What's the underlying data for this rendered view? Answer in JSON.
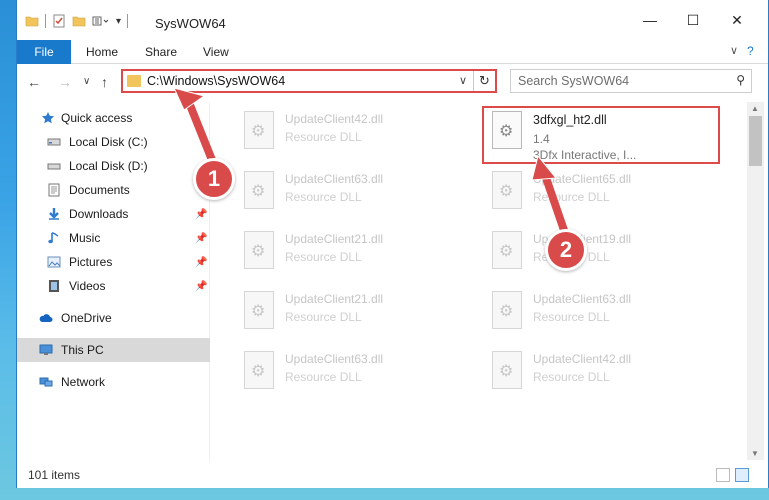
{
  "window": {
    "title": "SysWOW64"
  },
  "window_controls": {
    "minimize": "—",
    "maximize": "☐",
    "close": "✕"
  },
  "ribbon": {
    "tabs": [
      {
        "label": "File",
        "active": true
      },
      {
        "label": "Home"
      },
      {
        "label": "Share"
      },
      {
        "label": "View"
      }
    ],
    "help_icon": "?",
    "expand_icon": "∨"
  },
  "address_bar": {
    "path": "C:\\Windows\\SysWOW64",
    "refresh_icon": "↻",
    "chevron_icon": "∨"
  },
  "search": {
    "placeholder": "Search SysWOW64",
    "icon": "⚲"
  },
  "nav_buttons": {
    "back": "←",
    "forward": "→",
    "recent": "∨",
    "up": "↑"
  },
  "navigation_pane": {
    "items": [
      {
        "label": "Quick access",
        "icon": "star-icon",
        "pinned": false
      },
      {
        "label": "Local Disk (C:)",
        "icon": "drive-icon",
        "pinned": false
      },
      {
        "label": "Local Disk (D:)",
        "icon": "drive-icon",
        "pinned": false
      },
      {
        "label": "Documents",
        "icon": "documents-icon",
        "pinned": false
      },
      {
        "label": "Downloads",
        "icon": "download-icon",
        "pinned": true
      },
      {
        "label": "Music",
        "icon": "music-icon",
        "pinned": true
      },
      {
        "label": "Pictures",
        "icon": "pictures-icon",
        "pinned": true
      },
      {
        "label": "Videos",
        "icon": "videos-icon",
        "pinned": true
      },
      {
        "label": "OneDrive",
        "icon": "cloud-icon",
        "pinned": false
      },
      {
        "label": "This PC",
        "icon": "computer-icon",
        "pinned": false,
        "selected": true
      },
      {
        "label": "Network",
        "icon": "network-icon",
        "pinned": false
      }
    ],
    "pin_glyph": "📌"
  },
  "files": {
    "left_column": [
      {
        "name": "UpdateClient42.dll",
        "type": "Resource DLL"
      },
      {
        "name": "UpdateClient63.dll",
        "type": "Resource DLL"
      },
      {
        "name": "UpdateClient21.dll",
        "type": "Resource DLL"
      },
      {
        "name": "UpdateClient21.dll",
        "type": "Resource DLL"
      },
      {
        "name": "UpdateClient63.dll",
        "type": "Resource DLL"
      }
    ],
    "right_column": [
      {
        "name": "3dfxgl_ht2.dll",
        "type": "1.4",
        "desc": "3Dfx Interactive, I...",
        "highlighted": true
      },
      {
        "name": "UpdateClient65.dll",
        "type": "Resource DLL"
      },
      {
        "name": "UpdateClient19.dll",
        "type": "Resource DLL"
      },
      {
        "name": "UpdateClient63.dll",
        "type": "Resource DLL"
      },
      {
        "name": "UpdateClient42.dll",
        "type": "Resource DLL"
      }
    ]
  },
  "status_bar": {
    "item_count": "101 items"
  },
  "annotations": {
    "step1": "1",
    "step2": "2",
    "color": "#d94b4b"
  }
}
